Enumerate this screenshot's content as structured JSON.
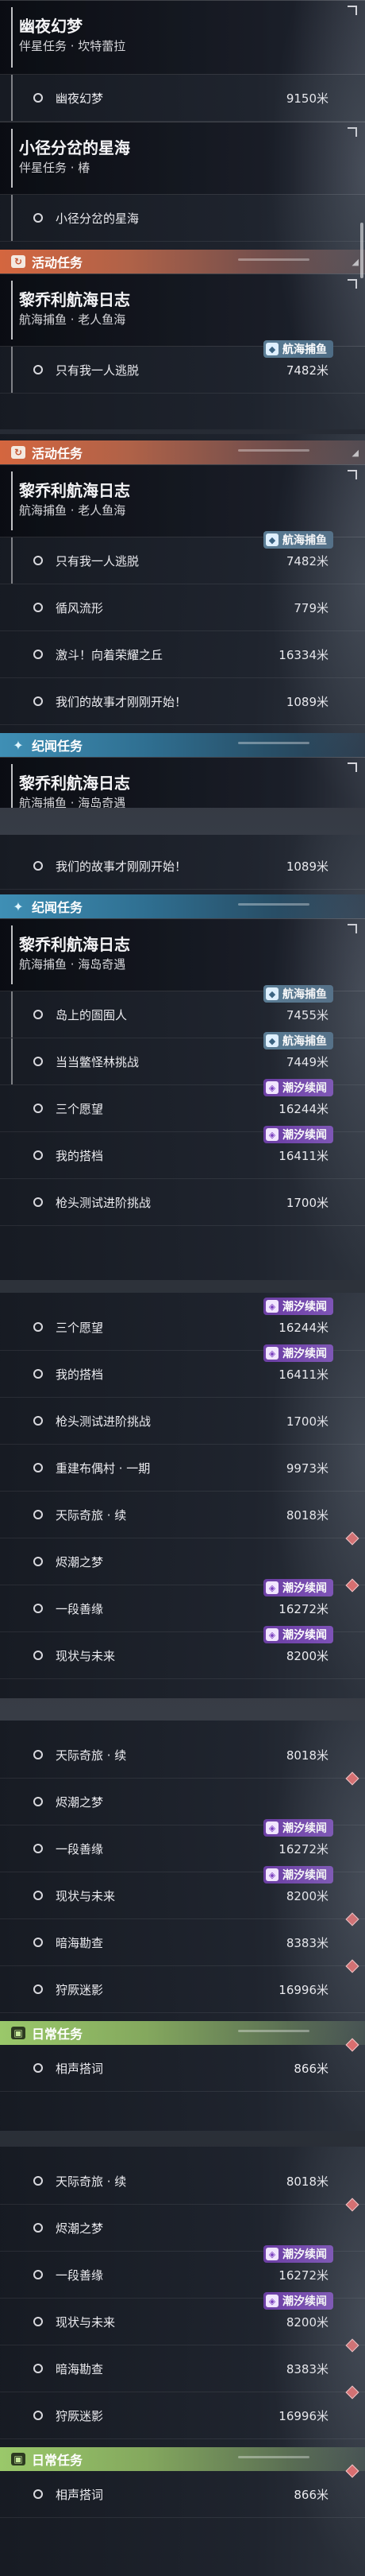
{
  "labels": {
    "distance_unit": "米"
  },
  "panel1": {
    "quests": [
      {
        "title": "幽夜幻梦",
        "subtitle": "伴星任务 · 坎特蕾拉",
        "subtasks": [
          {
            "name": "幽夜幻梦",
            "distance": "9150米"
          }
        ]
      },
      {
        "title": "小径分岔的星海",
        "subtitle": "伴星任务 · 椿",
        "subtasks": [
          {
            "name": "小径分岔的星海",
            "distance": ""
          }
        ]
      }
    ],
    "section": {
      "label": "活动任务"
    },
    "quest3": {
      "title": "黎乔利航海日志",
      "subtitle": "航海捕鱼 · 老人鱼海"
    },
    "row3": {
      "name": "只有我一人逃脱",
      "distance": "7482米",
      "badge": "航海捕鱼"
    }
  },
  "panel2": {
    "section": {
      "label": "活动任务"
    },
    "quest": {
      "title": "黎乔利航海日志",
      "subtitle": "航海捕鱼 · 老人鱼海"
    },
    "rows": [
      {
        "name": "只有我一人逃脱",
        "distance": "7482米",
        "badge": "航海捕鱼"
      },
      {
        "name": "循风流形",
        "distance": "779米"
      },
      {
        "name": "激斗！向着荣耀之丘",
        "distance": "16334米"
      },
      {
        "name": "我们的故事才刚刚开始！",
        "distance": "1089米"
      }
    ],
    "section2": {
      "label": "纪闻任务"
    },
    "quest2": {
      "title": "黎乔利航海日志",
      "subtitle": "航海捕鱼 · 海岛奇遇"
    }
  },
  "panel3": {
    "row": {
      "name": "我们的故事才刚刚开始！",
      "distance": "1089米"
    },
    "section": {
      "label": "纪闻任务"
    },
    "quest": {
      "title": "黎乔利航海日志",
      "subtitle": "航海捕鱼 · 海岛奇遇"
    },
    "rows": [
      {
        "name": "岛上的圄囿人",
        "distance": "7455米",
        "badge": "航海捕鱼"
      },
      {
        "name": "当当鳖怪林挑战",
        "distance": "7449米",
        "badge": "航海捕鱼"
      },
      {
        "name": "三个愿望",
        "distance": "16244米",
        "badge": "潮汐续闻"
      },
      {
        "name": "我的搭档",
        "distance": "16411米",
        "badge": "潮汐续闻"
      },
      {
        "name": "枪头测试进阶挑战",
        "distance": "1700米"
      }
    ]
  },
  "panel4": {
    "rows": [
      {
        "name": "三个愿望",
        "distance": "16244米",
        "badge": "潮汐续闻"
      },
      {
        "name": "我的搭档",
        "distance": "16411米",
        "badge": "潮汐续闻"
      },
      {
        "name": "枪头测试进阶挑战",
        "distance": "1700米"
      },
      {
        "name": "重建布偶村 · 一期",
        "distance": "9973米"
      },
      {
        "name": "天际奇旅 · 续",
        "distance": "8018米"
      },
      {
        "name": "烬潮之梦",
        "distance": ""
      },
      {
        "name": "一段善缘",
        "distance": "16272米",
        "badge": "潮汐续闻"
      },
      {
        "name": "现状与未来",
        "distance": "8200米",
        "badge": "潮汐续闻"
      }
    ]
  },
  "panel5": {
    "rows": [
      {
        "name": "天际奇旅 · 续",
        "distance": "8018米"
      },
      {
        "name": "烬潮之梦",
        "distance": ""
      },
      {
        "name": "一段善缘",
        "distance": "16272米",
        "badge": "潮汐续闻"
      },
      {
        "name": "现状与未来",
        "distance": "8200米",
        "badge": "潮汐续闻"
      },
      {
        "name": "暗海勘查",
        "distance": "8383米"
      },
      {
        "name": "狩厥迷影",
        "distance": "16996米"
      }
    ],
    "section": {
      "label": "日常任务"
    },
    "daily": {
      "name": "相声搭词",
      "distance": "866米"
    }
  },
  "panel6": {
    "rows": [
      {
        "name": "天际奇旅 · 续",
        "distance": "8018米"
      },
      {
        "name": "烬潮之梦",
        "distance": ""
      },
      {
        "name": "一段善缘",
        "distance": "16272米",
        "badge": "潮汐续闻"
      },
      {
        "name": "现状与未来",
        "distance": "8200米",
        "badge": "潮汐续闻"
      },
      {
        "name": "暗海勘查",
        "distance": "8383米"
      },
      {
        "name": "狩厥迷影",
        "distance": "16996米"
      }
    ],
    "section": {
      "label": "日常任务"
    },
    "daily": {
      "name": "相声搭词",
      "distance": "866米"
    }
  }
}
